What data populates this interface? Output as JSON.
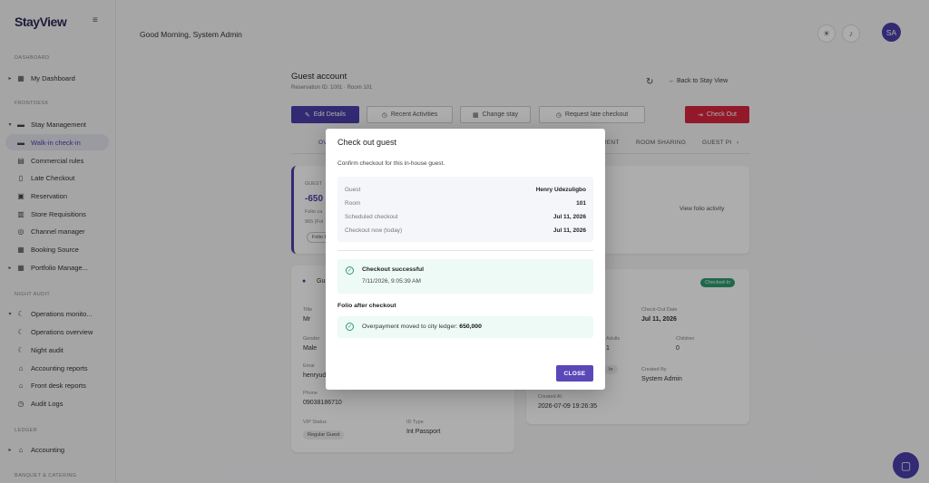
{
  "app": {
    "brand": "StayView"
  },
  "sidebar": {
    "sections": {
      "dashboard": "DASHBOARD",
      "frontdesk": "FRONTDESK",
      "night_audit": "NIGHT AUDIT",
      "ledger": "LEDGER",
      "banquet": "BANQUET & CATERING"
    },
    "items": [
      {
        "label": "My Dashboard"
      },
      {
        "label": "Stay Management"
      },
      {
        "label": "Walk-in check-in"
      },
      {
        "label": "Commercial rules"
      },
      {
        "label": "Late Checkout"
      },
      {
        "label": "Reservation"
      },
      {
        "label": "Store Requisitions"
      },
      {
        "label": "Channel manager"
      },
      {
        "label": "Booking Source"
      },
      {
        "label": "Portfolio Manage..."
      },
      {
        "label": "Operations monito..."
      },
      {
        "label": "Operations overview"
      },
      {
        "label": "Night audit"
      },
      {
        "label": "Accounting reports"
      },
      {
        "label": "Front desk reports"
      },
      {
        "label": "Audit Logs"
      },
      {
        "label": "Accounting"
      }
    ]
  },
  "header": {
    "greeting": "Good Morning, System Admin",
    "avatar_initials": "SA"
  },
  "page": {
    "title": "Guest account",
    "subtitle": "Reservation ID: 1001 · Room 101",
    "back_link": "Back to Stay View",
    "buttons": {
      "edit": "Edit Details",
      "recent": "Recent Activities",
      "change_stay": "Change stay",
      "late_checkout": "Request late checkout",
      "check_out": "Check Out"
    },
    "tabs": [
      "OV",
      "MENT",
      "ROOM SHARING",
      "GUEST PI"
    ],
    "folio_card": {
      "label": "GUEST",
      "amount": "-650",
      "line1": "Folio ca",
      "line2": "965 (Fol",
      "pill": "Folio B",
      "view_link": "View folio activity"
    },
    "guest_card": {
      "title": "Gu",
      "title_label": "Title",
      "title_val": "Mr",
      "gender_label": "Gender",
      "gender_val": "Male",
      "email_label": "Emai",
      "email_val": "henryud",
      "phone_label": "Phone",
      "phone_val": "09038186710",
      "vip_label": "VIP Status",
      "vip_val": "Regular Guest",
      "id_label": "ID Type",
      "id_val": "Int Passport"
    },
    "stay_card": {
      "badge": "Checked-In",
      "checkout_label": "Check-Out Date",
      "checkout_val": "Jul 11, 2026",
      "adults_label": "Adults",
      "adults_val": "1",
      "children_label": "Children",
      "children_val": "0",
      "in_tag": "In",
      "created_by_label": "Created By",
      "created_by_val": "System Admin",
      "created_at_label": "Created At",
      "created_at_val": "2026-07-09 19:26:35"
    }
  },
  "modal": {
    "title": "Check out guest",
    "description": "Confirm checkout for this in-house guest.",
    "rows": [
      {
        "k": "Guest",
        "v": "Henry Udezuligbo"
      },
      {
        "k": "Room",
        "v": "101"
      },
      {
        "k": "Scheduled checkout",
        "v": "Jul 11, 2026"
      },
      {
        "k": "Checkout now (today)",
        "v": "Jul 11, 2026"
      }
    ],
    "success_title": "Checkout successful",
    "success_time": "7/11/2026, 9:05:39 AM",
    "folio_title": "Folio after checkout",
    "folio_text": "Overpayment moved to city ledger:",
    "folio_amount": "650,000",
    "close_label": "CLOSE"
  },
  "colors": {
    "accent": "#4b3fa8",
    "danger": "#d7263d",
    "success": "#2e9b6f"
  }
}
